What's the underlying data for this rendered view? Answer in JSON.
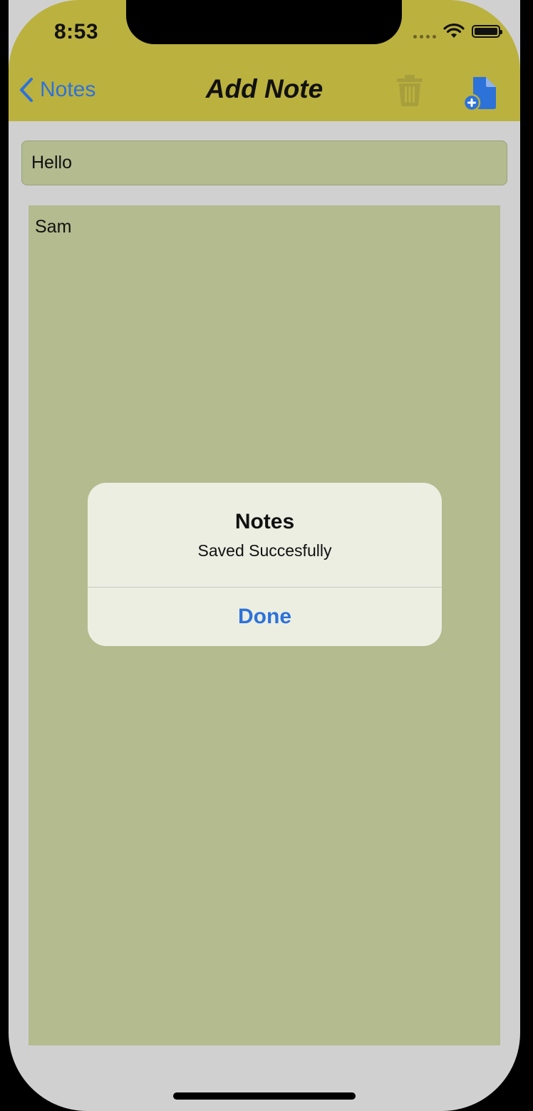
{
  "status_bar": {
    "time": "8:53",
    "icons": [
      "cellular-icon",
      "wifi-icon",
      "battery-icon"
    ]
  },
  "nav": {
    "back_label": "Notes",
    "title": "Add Note",
    "trash_icon": "trash-icon",
    "new_doc_icon": "new-document-icon",
    "bar_color": "#bbb13f",
    "accent_color": "#2d72d9"
  },
  "note": {
    "title_value": "Hello",
    "body_value": "Sam"
  },
  "alert": {
    "title": "Notes",
    "message": "Saved Succesfully",
    "button_label": "Done"
  },
  "colors": {
    "field_background": "#b3bb8f",
    "screen_background": "#d0d0d0",
    "alert_background": "#eceee2"
  }
}
